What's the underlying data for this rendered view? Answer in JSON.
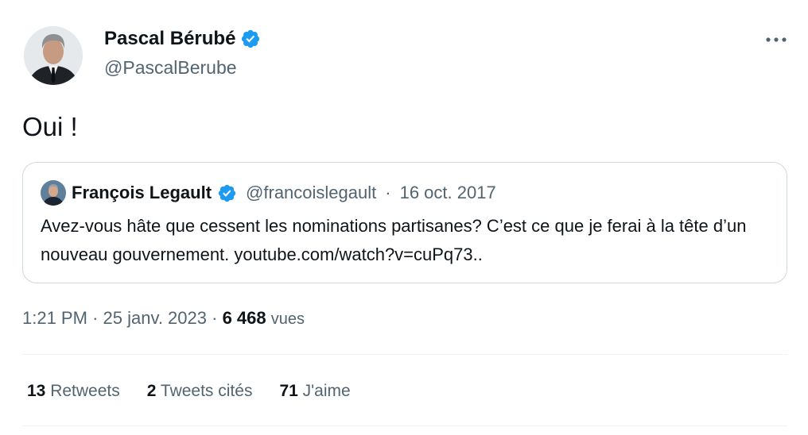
{
  "tweet": {
    "author": {
      "name": "Pascal Bérubé",
      "handle": "@PascalBerube",
      "verified": true
    },
    "text": "Oui !",
    "more_icon": "more-horizontal-icon"
  },
  "quote": {
    "name": "François Legault",
    "handle": "@francoislegault",
    "date": "16 oct. 2017",
    "separator": "·",
    "text": "Avez-vous hâte que cessent les nominations partisanes? C’est ce que je ferai à la tête d’un nouveau gouvernement. youtube.com/watch?v=cuPq73.."
  },
  "meta": {
    "time": "1:21 PM",
    "date": "25 janv. 2023",
    "separator": "·",
    "views_count": "6 468",
    "views_label": "vues"
  },
  "stats": {
    "retweets": {
      "count": "13",
      "label": "Retweets"
    },
    "quotes": {
      "count": "2",
      "label": "Tweets cités"
    },
    "likes": {
      "count": "71",
      "label": "J'aime"
    }
  },
  "colors": {
    "verified": "#1d9bf0",
    "secondary_text": "#536471",
    "primary_text": "#0f1419",
    "border": "#cfd9de"
  }
}
